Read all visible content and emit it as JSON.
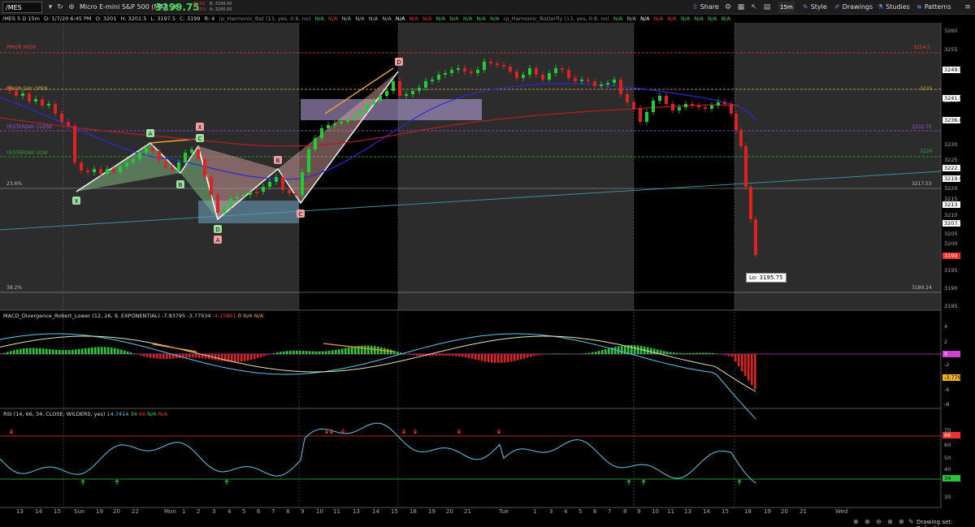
{
  "toolbar": {
    "symbol": "/MES",
    "description": "Micro E-mini S&P 500 (MAR 20)",
    "last_price": "3199.75",
    "change": "-35.50",
    "change_pct": "-1.10%",
    "bid": "B: 3199.00",
    "ask": "A: 3200.00",
    "share_label": "Share",
    "timeframe_label": "15m",
    "style_label": "Style",
    "drawings_label": "Drawings",
    "studies_label": "Studies",
    "patterns_label": "Patterns"
  },
  "infobar": {
    "header": "/MES 5 D 15m",
    "date": "D: 1/7/20 6:45 PM",
    "open": "O: 3201",
    "high": "H: 3201.5",
    "low": "L: 3197.5",
    "close": "C: 3199",
    "range": "R: 4",
    "study1": "rp_Harmonic_Bat (13, yes, 0.8, no)",
    "study2": "rp_Harmonic_Butterfly (13, yes, 0.8, no)",
    "na": "N/A"
  },
  "levels": {
    "prior_high": "PRIOR HIGH",
    "prior_day_open": "PRIOR DAY OPEN",
    "yesterday_close": "YESTERDAY CLOSE",
    "yesterday_low": "YESTERDAY LOW",
    "fib_236": "23.6%",
    "fib_382": "38.2%",
    "r_3254": "3254.5",
    "r_3245": "3245",
    "r_3232": "3232.75",
    "r_3226": "3226",
    "r_3217": "3217.53",
    "r_3189": "3189.24"
  },
  "price_axis": {
    "ticks": [
      "3260",
      "3255",
      "3250",
      "3245",
      "3240",
      "3235",
      "3230",
      "3225",
      "3220",
      "3215",
      "3210",
      "3205",
      "3200",
      "3195",
      "3190",
      "3185"
    ],
    "badges": [
      {
        "text": "3249.5",
        "color": "#ffffff"
      },
      {
        "text": "3241.51",
        "color": "#ffffff"
      },
      {
        "text": "3236.06",
        "color": "#ffffff"
      },
      {
        "text": "3222.75",
        "color": "#ffffff"
      },
      {
        "text": "3219.91",
        "color": "#ffffff"
      },
      {
        "text": "3213",
        "color": "#ffffff"
      },
      {
        "text": "3207.75",
        "color": "#ffffff"
      },
      {
        "text": "3199",
        "color": "#ff2a2a"
      }
    ],
    "low_label": "Lo: 3195.75"
  },
  "pattern_points": [
    "X",
    "A",
    "B",
    "C",
    "D",
    "X",
    "C",
    "A",
    "D",
    "B",
    "C",
    "D"
  ],
  "macd": {
    "title": "MACD_Divergence_Robert_Lower (12, 26, 9, EXPONENTIAL)",
    "v1": "-7.93795",
    "v2": "-3.77934",
    "v3": "-4.15861",
    "v4": "0",
    "na": "N/A",
    "ticks": [
      "4",
      "2",
      "0",
      "-2",
      "-4",
      "-6",
      "-8"
    ],
    "badge_zero": "0",
    "badge_val": "-3.7793"
  },
  "rsi": {
    "title": "RSI (14, 66, 34, CLOSE, WILDERS, yes)",
    "v1": "14.7414",
    "v2": "34",
    "v3": "66",
    "na": "N/A",
    "ticks": [
      "70",
      "60",
      "50",
      "40",
      "30"
    ],
    "badge_66": "66",
    "badge_34": "34"
  },
  "x_axis": [
    "13",
    "14",
    "15",
    "Sun",
    "19",
    "20",
    "22",
    "Mon",
    "1",
    "2",
    "3",
    "4",
    "5",
    "6",
    "7",
    "8",
    "9",
    "10",
    "11",
    "13",
    "14",
    "15",
    "18",
    "19",
    "20",
    "21",
    "Tue",
    "1",
    "3",
    "4",
    "5",
    "6",
    "7",
    "8",
    "9",
    "10",
    "11",
    "13",
    "14",
    "15",
    "18",
    "19",
    "20",
    "21",
    "Wed"
  ],
  "status": {
    "drawing_set": "Drawing set: Default"
  },
  "colors": {
    "up": "#22cc33",
    "down": "#dd2222",
    "accent": "#5b9cf0"
  }
}
